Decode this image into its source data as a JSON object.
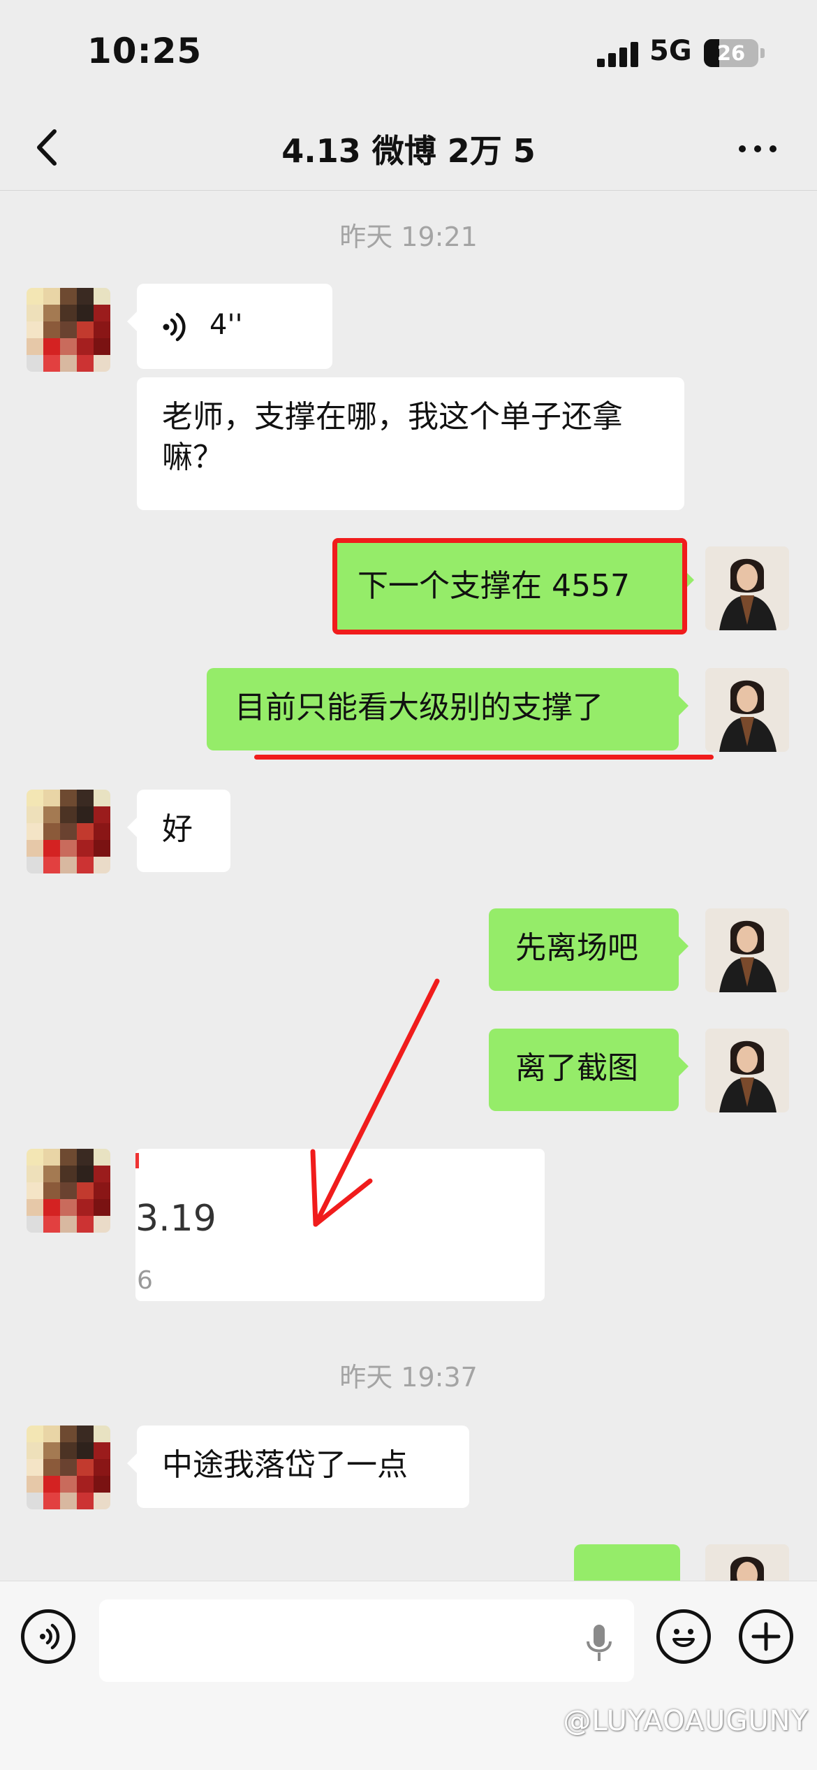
{
  "status_bar": {
    "time": "10:25",
    "network": "5G",
    "battery": "26"
  },
  "header": {
    "title": "4.13 微博 2万 5",
    "back_icon": "chevron-left-icon",
    "more_icon": "more-dots-icon"
  },
  "timestamps": [
    "昨天 19:21",
    "昨天 19:37"
  ],
  "messages": {
    "voice_duration": "4''",
    "m1": "老师，支撑在哪，我这个单子还拿嘛？",
    "m2": "下一个支撑在 4557",
    "m3": "目前只能看大级别的支撑了",
    "m4": "好",
    "m5": "先离场吧",
    "m6": "离了截图",
    "screenshot_value": "3.19",
    "screenshot_sub": "6",
    "m7": "中途我落岱了一点"
  },
  "input_bar": {
    "voice_icon": "voice-input-icon",
    "mic_icon": "microphone-icon",
    "emoji_icon": "emoji-icon",
    "plus_icon": "plus-icon"
  },
  "watermark": "@LUYAOAUGUNY",
  "colors": {
    "background": "#ededed",
    "sent_bubble": "#95ec69",
    "received_bubble": "#ffffff",
    "annotation": "#f01c1c"
  }
}
